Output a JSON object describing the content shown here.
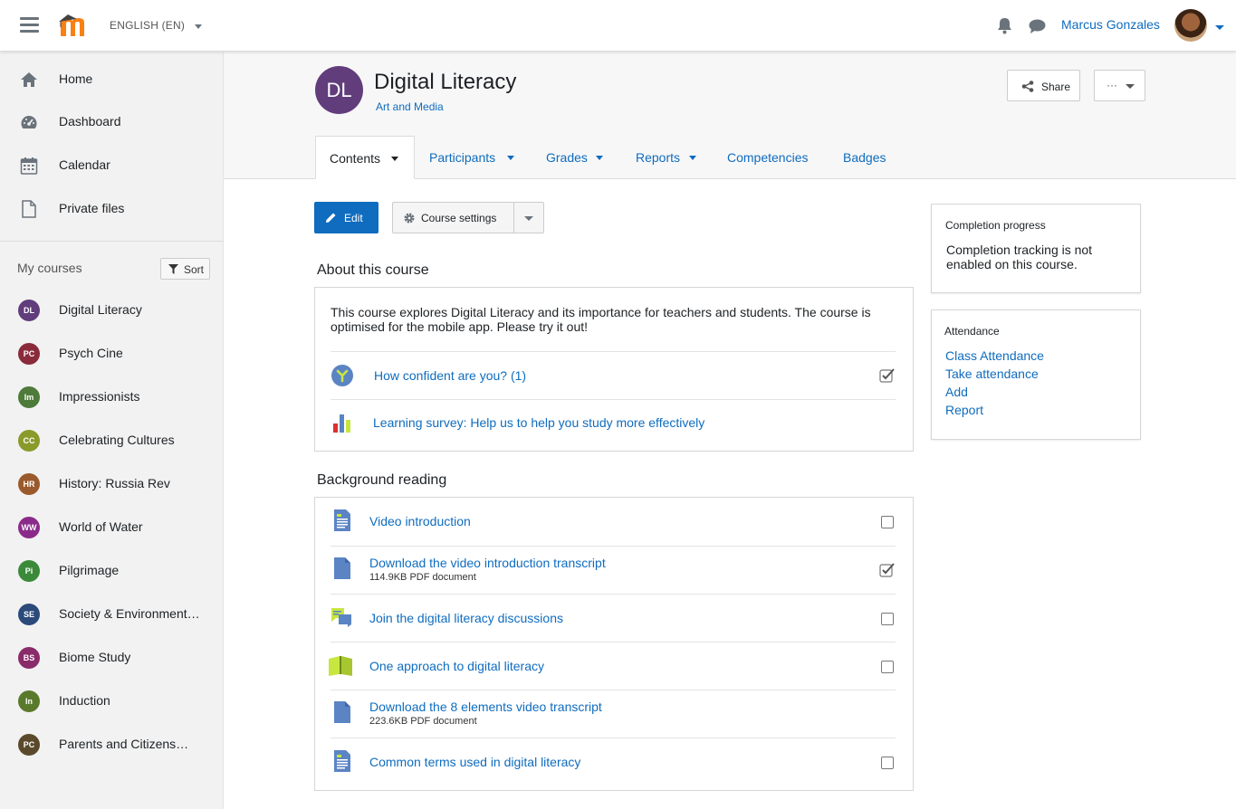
{
  "navbar": {
    "language": "ENGLISH (EN)",
    "username": "Marcus Gonzales"
  },
  "sidebar": {
    "items": [
      {
        "label": "Home",
        "icon": "home-icon"
      },
      {
        "label": "Dashboard",
        "icon": "dashboard-icon"
      },
      {
        "label": "Calendar",
        "icon": "calendar-icon"
      },
      {
        "label": "Private files",
        "icon": "file-icon"
      }
    ],
    "my_courses_label": "My courses",
    "sort_label": "Sort",
    "courses": [
      {
        "abbr": "DL",
        "name": "Digital Literacy",
        "color": "#613d7c"
      },
      {
        "abbr": "PC",
        "name": "Psych Cine",
        "color": "#8a2b3b"
      },
      {
        "abbr": "Im",
        "name": "Impressionists",
        "color": "#4e7a3a"
      },
      {
        "abbr": "CC",
        "name": "Celebrating Cultures",
        "color": "#8a9a2b"
      },
      {
        "abbr": "HR",
        "name": "History: Russia Rev",
        "color": "#9a5a2b"
      },
      {
        "abbr": "WW",
        "name": "World of Water",
        "color": "#8a2b8a"
      },
      {
        "abbr": "Pi",
        "name": "Pilgrimage",
        "color": "#3a8a3a"
      },
      {
        "abbr": "SE",
        "name": "Society & Environment…",
        "color": "#2b4a7a"
      },
      {
        "abbr": "BS",
        "name": "Biome Study",
        "color": "#8a2b6a"
      },
      {
        "abbr": "In",
        "name": "Induction",
        "color": "#5a7a2b"
      },
      {
        "abbr": "PC",
        "name": "Parents and Citizens…",
        "color": "#5a4a2b"
      }
    ]
  },
  "course": {
    "avatar": "DL",
    "title": "Digital Literacy",
    "category": "Art and Media",
    "share_label": "Share",
    "more_label": "···"
  },
  "tabs": [
    {
      "label": "Contents"
    },
    {
      "label": "Participants"
    },
    {
      "label": "Grades"
    },
    {
      "label": "Reports"
    },
    {
      "label": "Competencies"
    },
    {
      "label": "Badges"
    }
  ],
  "actions": {
    "edit_label": "Edit",
    "settings_label": "Course settings"
  },
  "about": {
    "title": "About this course",
    "text": "This course explores Digital Literacy and its importance for teachers and students. The course is optimised for the mobile app. Please try it out!",
    "items": [
      {
        "label": "How confident are you? (1)",
        "completed": true
      },
      {
        "label": "Learning survey: Help us to help you study more effectively"
      }
    ]
  },
  "background": {
    "title": "Background reading",
    "items": [
      {
        "label": "Video introduction",
        "completed": false
      },
      {
        "label": "Download the video introduction transcript",
        "meta": "114.9KB PDF document",
        "completed": true
      },
      {
        "label": "Join the digital literacy discussions",
        "completed": false
      },
      {
        "label": "One approach to digital literacy",
        "completed": false
      },
      {
        "label": "Download the 8 elements video transcript",
        "meta": "223.6KB PDF document"
      },
      {
        "label": "Common terms used in digital literacy",
        "completed": false
      }
    ]
  },
  "blocks": {
    "completion": {
      "title": "Completion progress",
      "text": "Completion tracking is not enabled on this course."
    },
    "attendance": {
      "title": "Attendance",
      "links": [
        "Class Attendance",
        "Take attendance",
        "Add",
        "Report"
      ]
    }
  }
}
